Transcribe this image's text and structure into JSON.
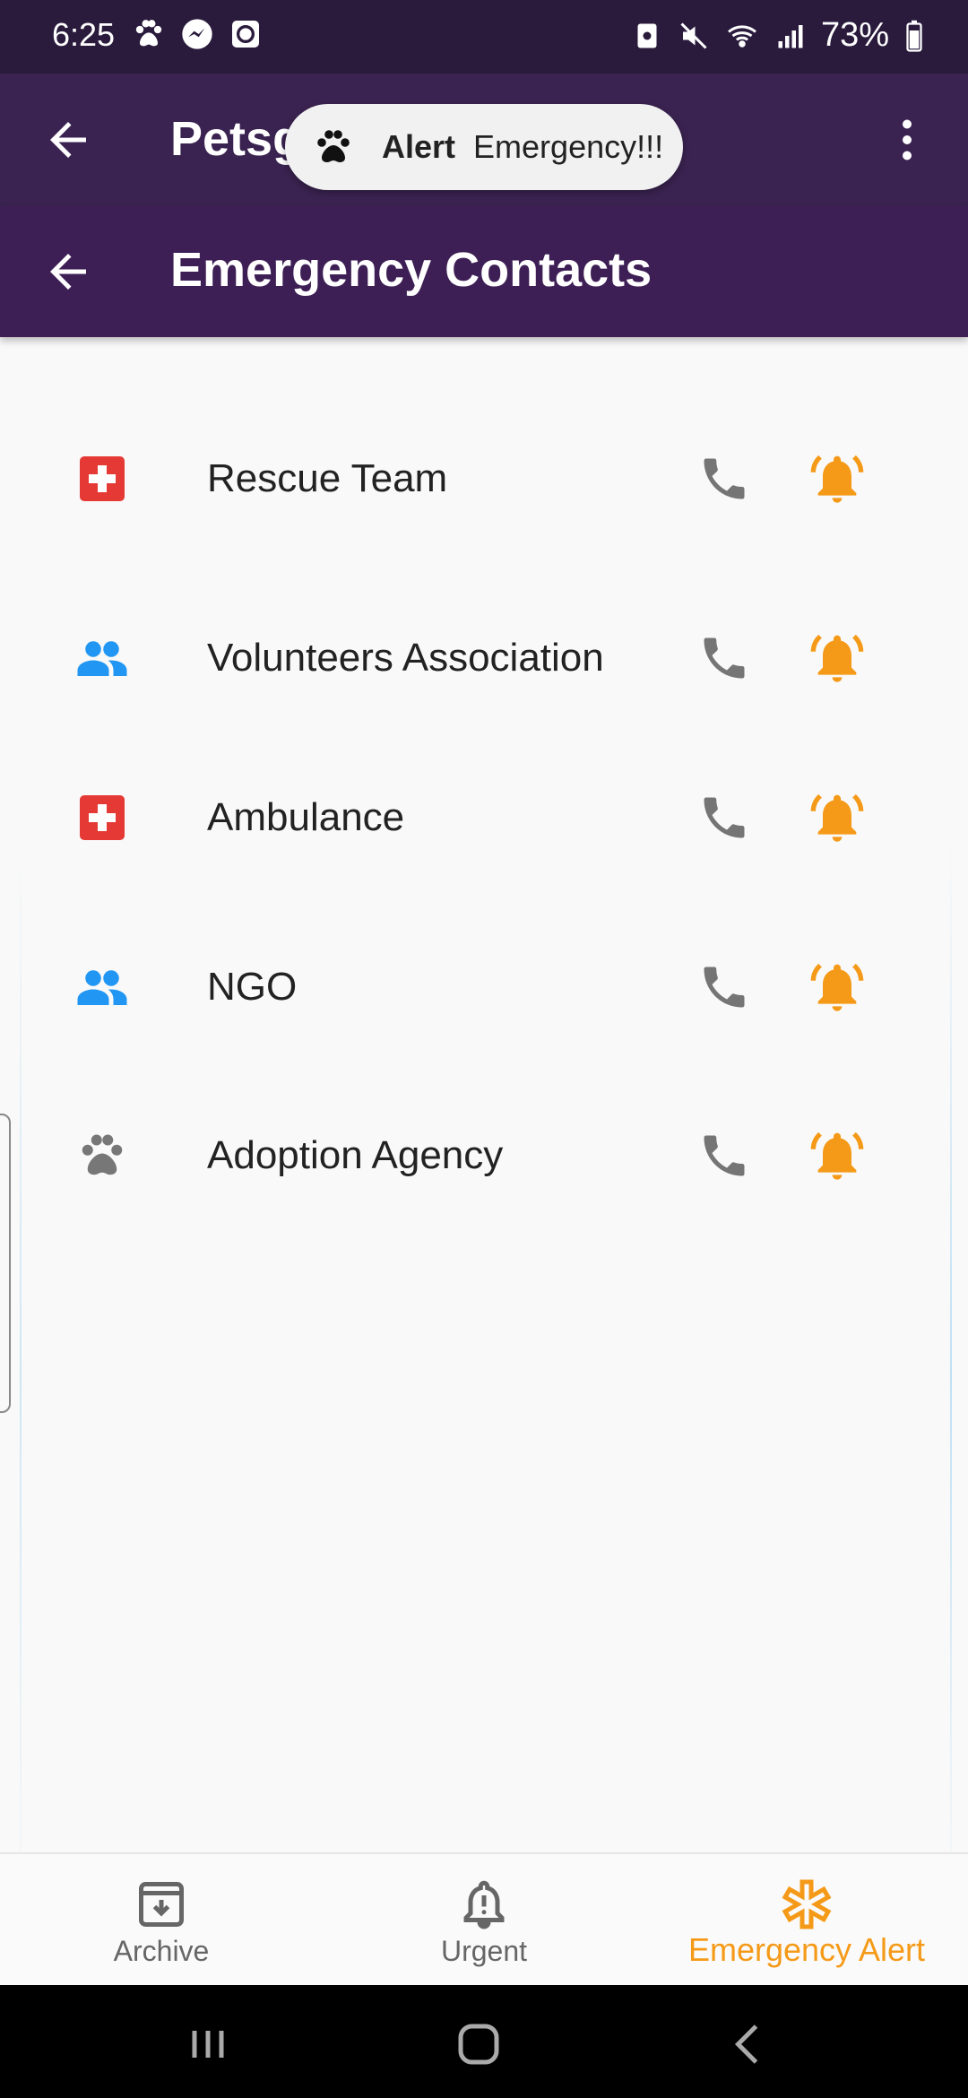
{
  "status_bar": {
    "time": "6:25",
    "battery": "73%"
  },
  "app_bar": {
    "title": "Petsg"
  },
  "toast": {
    "title": "Alert",
    "message": "Emergency!!!"
  },
  "sub_bar": {
    "title": "Emergency Contacts"
  },
  "contacts": [
    {
      "name": "Rescue Team",
      "icon": "medical-cross-icon"
    },
    {
      "name": "Volunteers Association",
      "icon": "people-icon"
    },
    {
      "name": "Ambulance",
      "icon": "medical-cross-icon"
    },
    {
      "name": "NGO",
      "icon": "people-icon"
    },
    {
      "name": "Adoption Agency",
      "icon": "paw-icon"
    }
  ],
  "bottom_nav": {
    "archive": "Archive",
    "urgent": "Urgent",
    "emergency": "Emergency Alert"
  },
  "colors": {
    "accent": "#f59a18",
    "purple": "#3e1f55",
    "medical": "#e53935",
    "people": "#2196f3",
    "paw": "#777777",
    "call": "#757575"
  }
}
